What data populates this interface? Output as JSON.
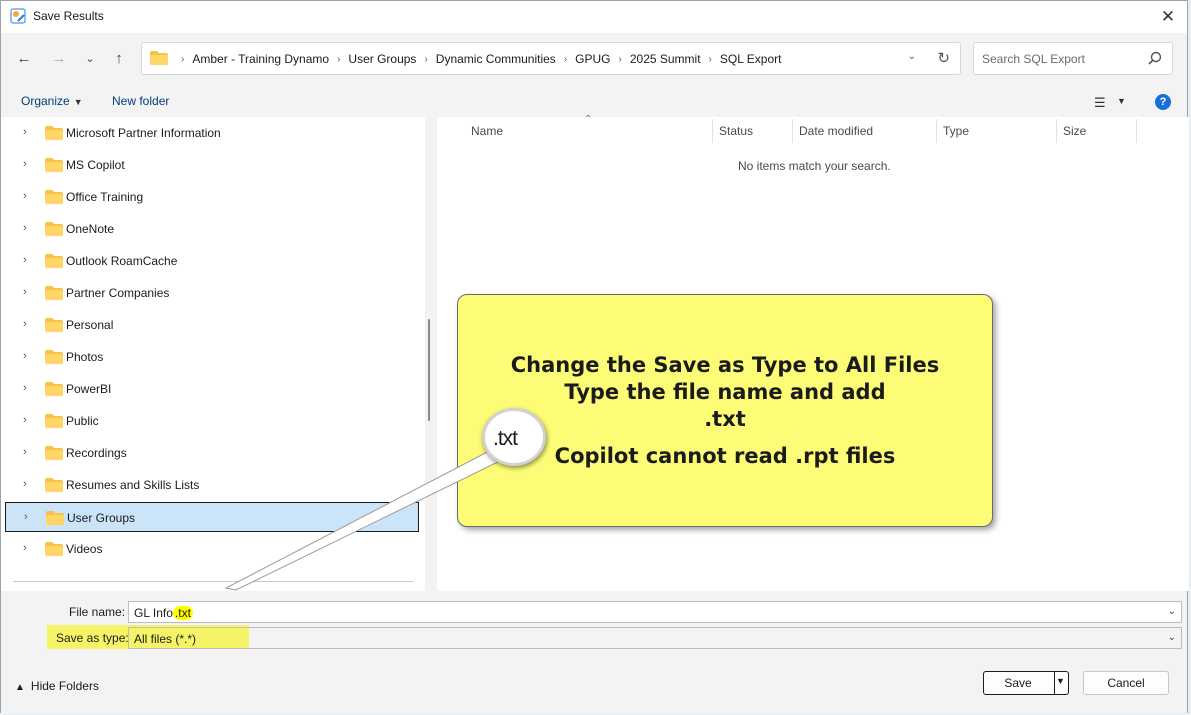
{
  "window": {
    "title": "Save Results"
  },
  "nav": {
    "breadcrumbs": [
      "Amber - Training Dynamo",
      "User Groups",
      "Dynamic Communities",
      "GPUG",
      "2025 Summit",
      "SQL Export"
    ],
    "search_placeholder": "Search SQL Export"
  },
  "commandbar": {
    "organize_label": "Organize",
    "new_folder_label": "New folder"
  },
  "tree": {
    "items": [
      {
        "label": "Microsoft Partner Information",
        "selected": false
      },
      {
        "label": "MS Copilot",
        "selected": false
      },
      {
        "label": "Office Training",
        "selected": false
      },
      {
        "label": "OneNote",
        "selected": false
      },
      {
        "label": "Outlook RoamCache",
        "selected": false
      },
      {
        "label": "Partner Companies",
        "selected": false
      },
      {
        "label": "Personal",
        "selected": false
      },
      {
        "label": "Photos",
        "selected": false
      },
      {
        "label": "PowerBI",
        "selected": false
      },
      {
        "label": "Public",
        "selected": false
      },
      {
        "label": "Recordings",
        "selected": false
      },
      {
        "label": "Resumes and Skills Lists",
        "selected": false
      },
      {
        "label": "User Groups",
        "selected": true
      },
      {
        "label": "Videos",
        "selected": false
      }
    ]
  },
  "filelist": {
    "columns": [
      "Name",
      "Status",
      "Date modified",
      "Type",
      "Size"
    ],
    "empty_message": "No items match your search."
  },
  "bottom": {
    "file_name_label": "File name:",
    "file_name_base": "GL Info",
    "file_name_ext": ".txt",
    "save_type_label": "Save as type:",
    "save_type_value": "All files (*.*)",
    "hide_folders_label": "Hide Folders",
    "save_label": "Save",
    "cancel_label": "Cancel"
  },
  "callout": {
    "line1": "Change the Save as Type to All Files",
    "line2": "Type the file name and add",
    "line3": ".txt",
    "line4": "Copilot cannot read .rpt files",
    "magnifier_text": ".txt"
  },
  "colors": {
    "callout_bg": "#fcfc77",
    "highlight": "#ffff00",
    "selected_bg": "#cce4f7",
    "accent": "#1a6ed8",
    "folder": "#f4c542"
  }
}
